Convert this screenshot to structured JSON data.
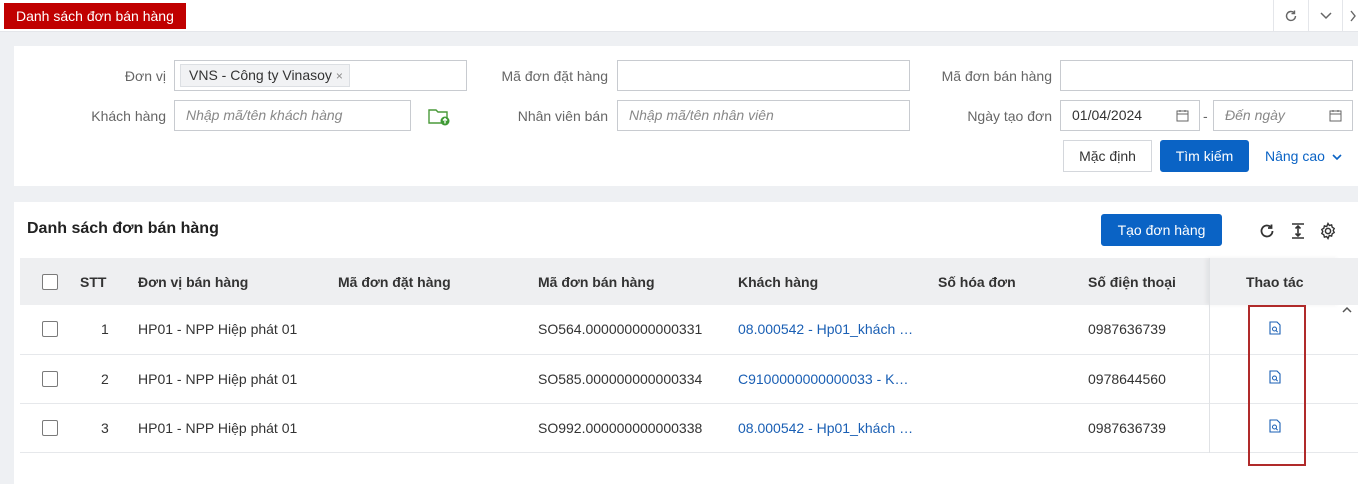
{
  "header": {
    "active_tab": "Danh sách đơn bán hàng",
    "icons": [
      "refresh-icon",
      "chevron-down-icon",
      "more-icon"
    ]
  },
  "filters": {
    "don_vi": {
      "label": "Đơn vị",
      "chip": "VNS - Công ty Vinasoy",
      "chip_remove": "×"
    },
    "ma_don_dat_hang": {
      "label": "Mã đơn đặt hàng",
      "value": ""
    },
    "ma_don_ban_hang": {
      "label": "Mã đơn bán hàng",
      "value": ""
    },
    "khach_hang": {
      "label": "Khách hàng",
      "placeholder": "Nhập mã/tên khách hàng"
    },
    "nhan_vien_ban": {
      "label": "Nhân viên bán",
      "placeholder": "Nhập mã/tên nhân viên"
    },
    "ngay_tao_don": {
      "label": "Ngày tạo đơn",
      "from": "01/04/2024",
      "separator": "-",
      "to_placeholder": "Đến ngày"
    },
    "buttons": {
      "default": "Mặc định",
      "search": "Tìm kiếm",
      "advanced": "Nâng cao"
    }
  },
  "list": {
    "title": "Danh sách đơn bán hàng",
    "create_button": "Tạo đơn hàng",
    "columns": [
      "STT",
      "Đơn vị bán hàng",
      "Mã đơn đặt hàng",
      "Mã đơn bán hàng",
      "Khách hàng",
      "Số hóa đơn",
      "Số điện thoại",
      "Thao tác"
    ],
    "rows": [
      {
        "stt": "1",
        "don_vi": "HP01 - NPP Hiệp phát 01",
        "ma_dat": "",
        "ma_ban": "SO564.000000000000331",
        "khach_hang": "08.000542 - Hp01_khách …",
        "so_hoa_don": "",
        "sdt": "0987636739"
      },
      {
        "stt": "2",
        "don_vi": "HP01 - NPP Hiệp phát 01",
        "ma_dat": "",
        "ma_ban": "SO585.000000000000334",
        "khach_hang": "C9100000000000033 - K…",
        "so_hoa_don": "",
        "sdt": "0978644560"
      },
      {
        "stt": "3",
        "don_vi": "HP01 - NPP Hiệp phát 01",
        "ma_dat": "",
        "ma_ban": "SO992.000000000000338",
        "khach_hang": "08.000542 - Hp01_khách …",
        "so_hoa_don": "",
        "sdt": "0987636739"
      }
    ]
  },
  "colors": {
    "tab_red": "#c00000",
    "primary": "#0a63c5",
    "link": "#1a5fb4",
    "highlight_border": "#b02a2a"
  }
}
